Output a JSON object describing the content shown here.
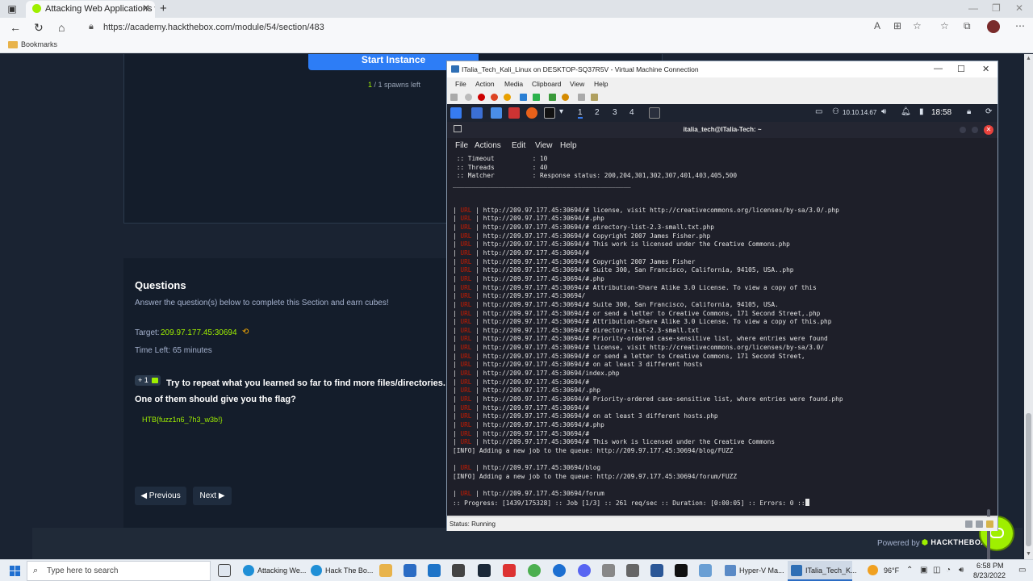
{
  "browser": {
    "tab_title": "Attacking Web Applications with",
    "url": "https://academy.hackthebox.com/module/54/section/483",
    "bookmarks_label": "Bookmarks"
  },
  "page": {
    "start_button": "Start Instance",
    "spawns_count": "1",
    "spawns_text": " / 1 spawns left",
    "questions_title": "Questions",
    "questions_sub": "Answer the question(s) below to complete this Section and earn cubes!",
    "target_label": "Target:",
    "target_value": "209.97.177.45:30694",
    "time_left": "Time Left: 65 minutes",
    "badge": "+ 1",
    "question_text": "Try to repeat what you learned so far to find more files/directories. One of them should give you the flag?",
    "answer": "HTB{fuzz1n6_7h3_w3b!}",
    "prev_button": "Previous",
    "next_button": "Next",
    "powered_by": "Powered by",
    "logo_text": "HACKTHEBOX"
  },
  "vm": {
    "title": "ITalia_Tech_Kali_Linux on DESKTOP-SQ37R5V - Virtual Machine Connection",
    "menu": [
      "File",
      "Action",
      "Media",
      "Clipboard",
      "View",
      "Help"
    ],
    "workspaces": [
      "1",
      "2",
      "3",
      "4"
    ],
    "ip": "10.10.14.67",
    "clock": "18:58",
    "status": "Status: Running"
  },
  "terminal": {
    "title": "italia_tech@ITalia-Tech: ~",
    "menu": [
      "File",
      "Actions",
      "Edit",
      "View",
      "Help"
    ],
    "header_lines": [
      " :: Timeout          : 10",
      " :: Threads          : 40",
      " :: Matcher          : Response status: 200,204,301,302,307,401,403,405,500",
      "_______________________________________________"
    ],
    "url_lines": [
      "http://209.97.177.45:30694/# license, visit http://creativecommons.org/licenses/by-sa/3.0/.php",
      "http://209.97.177.45:30694/#.php",
      "http://209.97.177.45:30694/# directory-list-2.3-small.txt.php",
      "http://209.97.177.45:30694/# Copyright 2007 James Fisher.php",
      "http://209.97.177.45:30694/# This work is licensed under the Creative Commons.php",
      "http://209.97.177.45:30694/#",
      "http://209.97.177.45:30694/# Copyright 2007 James Fisher",
      "http://209.97.177.45:30694/# Suite 300, San Francisco, California, 94105, USA..php",
      "http://209.97.177.45:30694/#.php",
      "http://209.97.177.45:30694/# Attribution-Share Alike 3.0 License. To view a copy of this",
      "http://209.97.177.45:30694/",
      "http://209.97.177.45:30694/# Suite 300, San Francisco, California, 94105, USA.",
      "http://209.97.177.45:30694/# or send a letter to Creative Commons, 171 Second Street,.php",
      "http://209.97.177.45:30694/# Attribution-Share Alike 3.0 License. To view a copy of this.php",
      "http://209.97.177.45:30694/# directory-list-2.3-small.txt",
      "http://209.97.177.45:30694/# Priority-ordered case-sensitive list, where entries were found",
      "http://209.97.177.45:30694/# license, visit http://creativecommons.org/licenses/by-sa/3.0/",
      "http://209.97.177.45:30694/# or send a letter to Creative Commons, 171 Second Street,",
      "http://209.97.177.45:30694/# on at least 3 different hosts",
      "http://209.97.177.45:30694/index.php",
      "http://209.97.177.45:30694/#",
      "http://209.97.177.45:30694/.php",
      "http://209.97.177.45:30694/# Priority-ordered case-sensitive list, where entries were found.php",
      "http://209.97.177.45:30694/#",
      "http://209.97.177.45:30694/# on at least 3 different hosts.php",
      "http://209.97.177.45:30694/#.php",
      "http://209.97.177.45:30694/#",
      "http://209.97.177.45:30694/# This work is licensed under the Creative Commons"
    ],
    "url_tag": "URL",
    "info_line_1": "[INFO] Adding a new job to the queue: http://209.97.177.45:30694/blog/FUZZ",
    "url_blog": "http://209.97.177.45:30694/blog",
    "info_line_2": "[INFO] Adding a new job to the queue: http://209.97.177.45:30694/forum/FUZZ",
    "url_forum": "http://209.97.177.45:30694/forum",
    "progress_line": ":: Progress: [1439/175328] :: Job [1/3] :: 261 req/sec :: Duration: [0:00:05] :: Errors: 0 ::"
  },
  "taskbar": {
    "search_placeholder": "Type here to search",
    "apps": [
      "Attacking We...",
      "Hack The Bo...",
      "Hyper-V Ma...",
      "ITalia_Tech_K..."
    ],
    "weather": "96°F",
    "time": "6:58 PM",
    "date": "8/23/2022"
  }
}
